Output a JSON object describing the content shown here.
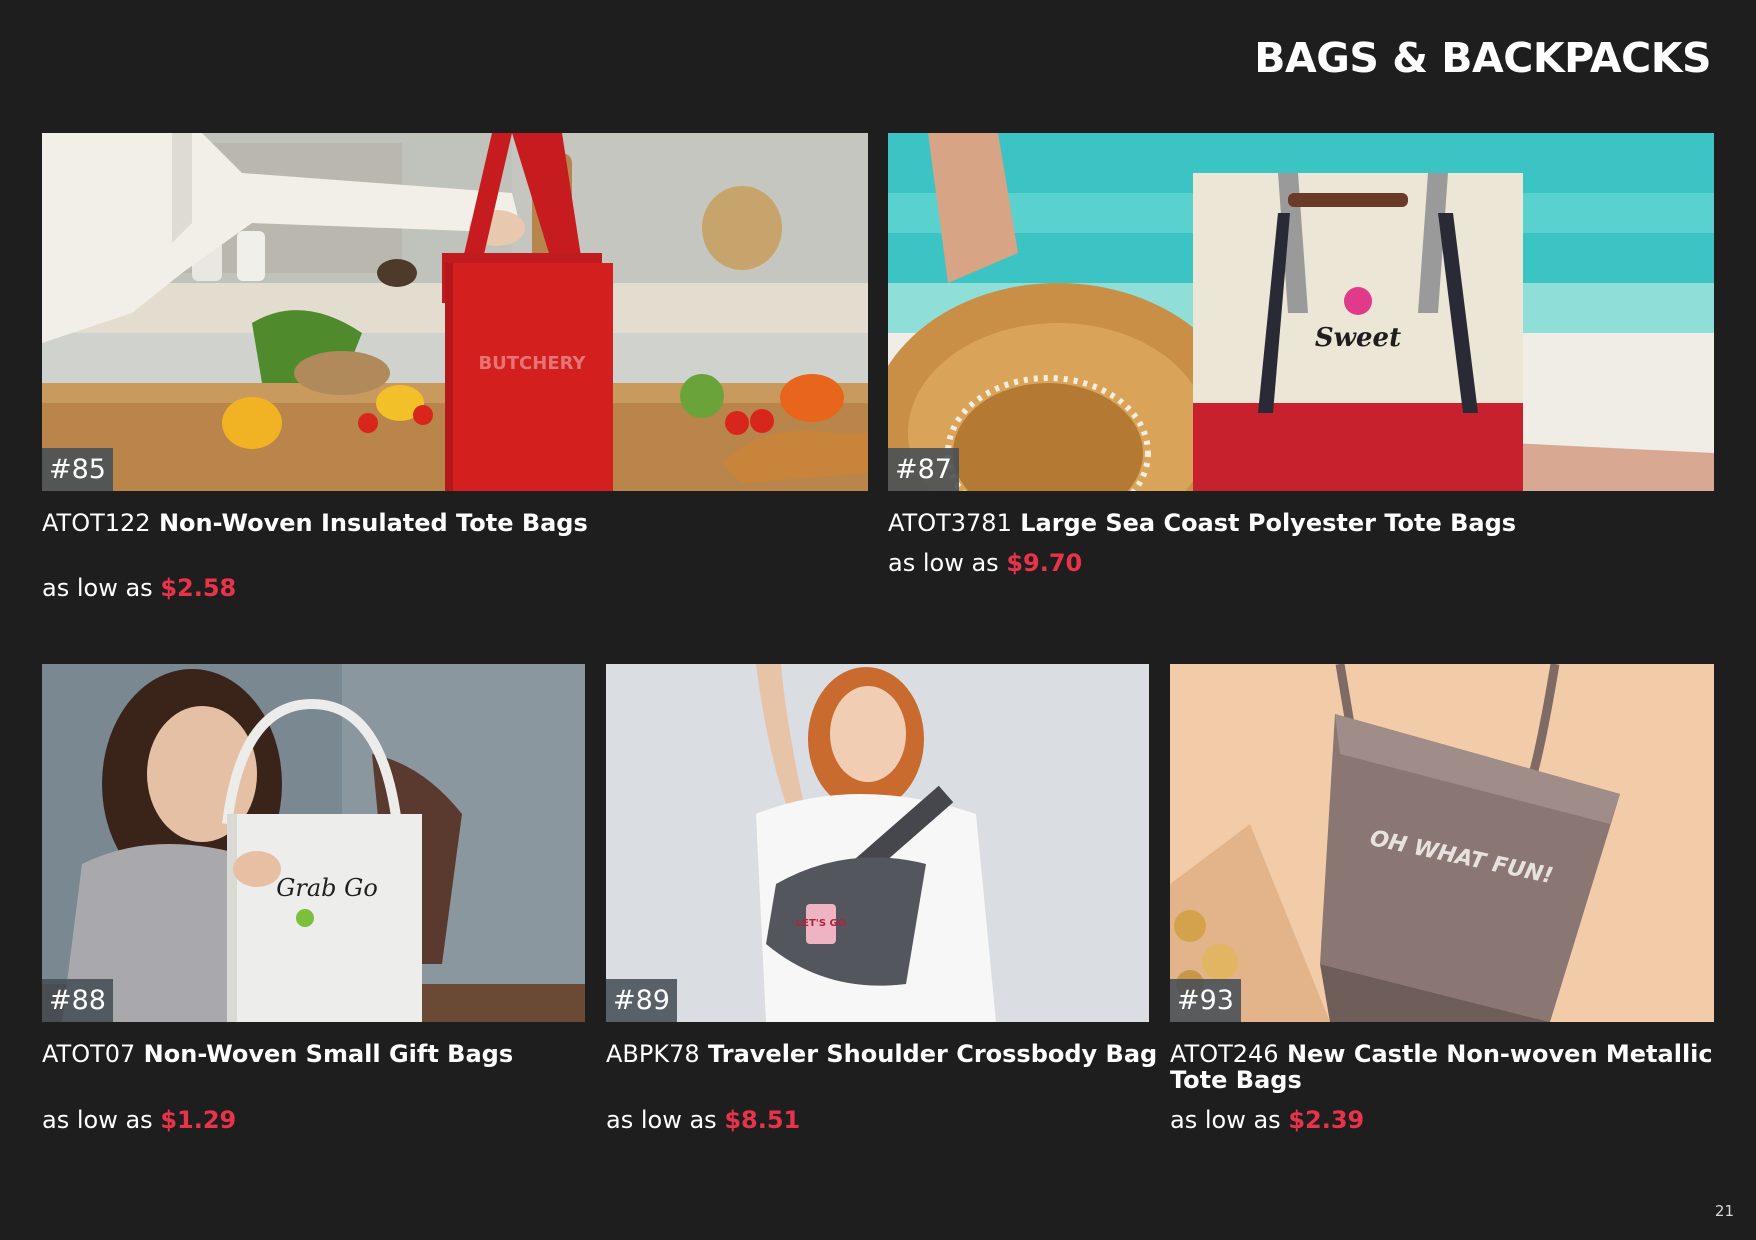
{
  "page": {
    "title": "BAGS & BACKPACKS",
    "page_number": "21"
  },
  "products": [
    {
      "number": "#85",
      "sku": "ATOT122",
      "name": "Non-Woven Insulated Tote Bags",
      "price_prefix": "as low as",
      "price": "$2.58",
      "image_text": "BUTCHERY"
    },
    {
      "number": "#87",
      "sku": "ATOT3781",
      "name": "Large Sea Coast Polyester Tote Bags",
      "price_prefix": "as low as",
      "price": "$9.70",
      "image_text": "Sweet"
    },
    {
      "number": "#88",
      "sku": "ATOT07",
      "name": "Non-Woven Small Gift Bags",
      "price_prefix": "as low as",
      "price": "$1.29",
      "image_text": "Grab Go"
    },
    {
      "number": "#89",
      "sku": "ABPK78",
      "name": "Traveler Shoulder Crossbody Bag",
      "price_prefix": "as low as",
      "price": "$8.51",
      "image_text": "LET'S GO"
    },
    {
      "number": "#93",
      "sku": "ATOT246",
      "name": "New Castle Non-woven Metallic Tote Bags",
      "price_prefix": "as low as",
      "price": "$2.39",
      "image_text": "OH WHAT FUN!"
    }
  ],
  "colors": {
    "background": "#1f1e1e",
    "price_accent": "#e8334a",
    "badge": "#464e56"
  }
}
